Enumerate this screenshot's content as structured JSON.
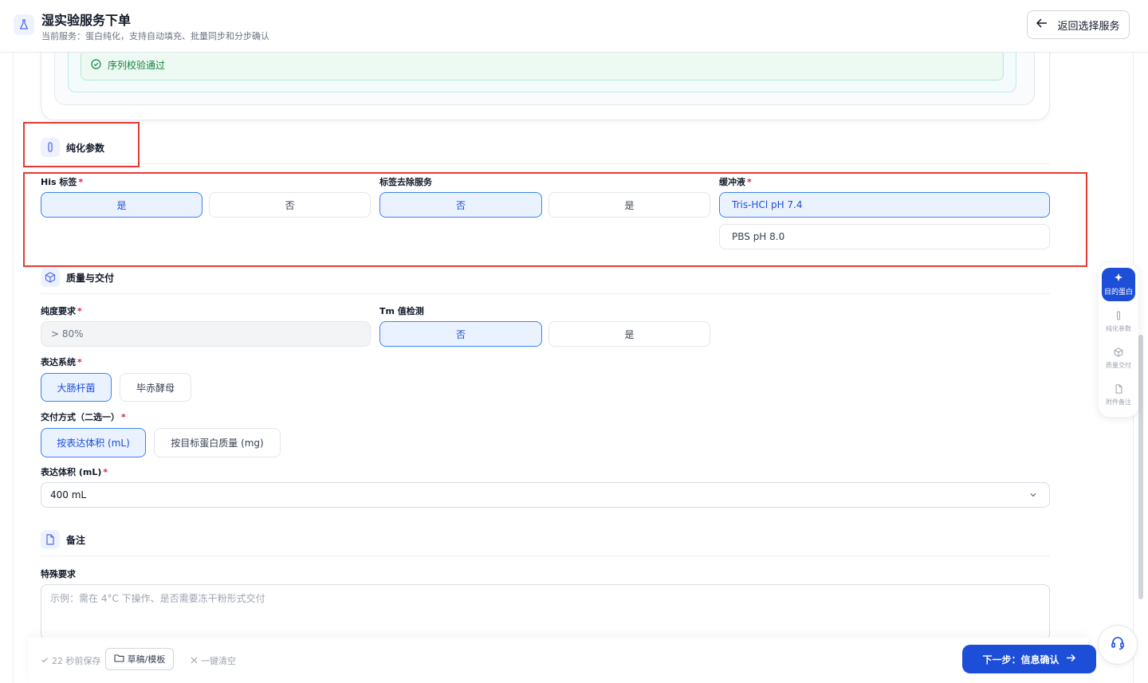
{
  "header": {
    "title": "湿实验服务下单",
    "subtitle": "当前服务：蛋白纯化，支持自动填充、批量同步和分步确认",
    "back_label": "返回选择服务"
  },
  "verify": {
    "text": "序列校验通过"
  },
  "purification": {
    "title": "纯化参数",
    "his_tag": {
      "label": "His 标签",
      "options": [
        "是",
        "否"
      ],
      "selected": "是"
    },
    "tag_removal": {
      "label": "标签去除服务",
      "options": [
        "否",
        "是"
      ],
      "selected": "否"
    },
    "buffer": {
      "label": "缓冲液",
      "options": [
        "Tris-HCl pH 7.4",
        "PBS pH 8.0"
      ],
      "selected": "Tris-HCl pH 7.4"
    }
  },
  "quality": {
    "title": "质量与交付",
    "purity": {
      "label": "纯度要求",
      "value": "> 80%"
    },
    "tm": {
      "label": "Tm 值检测",
      "options": [
        "否",
        "是"
      ],
      "selected": "否"
    },
    "expression": {
      "label": "表达系统",
      "options": [
        "大肠杆菌",
        "毕赤酵母"
      ],
      "selected": "大肠杆菌"
    },
    "delivery": {
      "label": "交付方式（二选一）",
      "options": [
        "按表达体积 (mL)",
        "按目标蛋白质量 (mg)"
      ],
      "selected": "按表达体积 (mL)"
    },
    "volume": {
      "label": "表达体积 (mL)",
      "value": "400 mL"
    }
  },
  "notes": {
    "title": "备注",
    "special": {
      "label": "特殊要求",
      "placeholder": "示例：需在 4°C 下操作、是否需要冻干粉形式交付"
    }
  },
  "side_nav": {
    "items": [
      "目的蛋白",
      "纯化参数",
      "质量交付",
      "附件备注"
    ],
    "active": "目的蛋白"
  },
  "footer": {
    "saved": "22 秒前保存",
    "draft": "草稿/模板",
    "clear": "一键清空",
    "next": "下一步：信息确认"
  },
  "colors": {
    "primary": "#1d4ed8",
    "selected_bg": "#eaf2ff",
    "success": "#15803d",
    "annotation": "#e53935"
  }
}
